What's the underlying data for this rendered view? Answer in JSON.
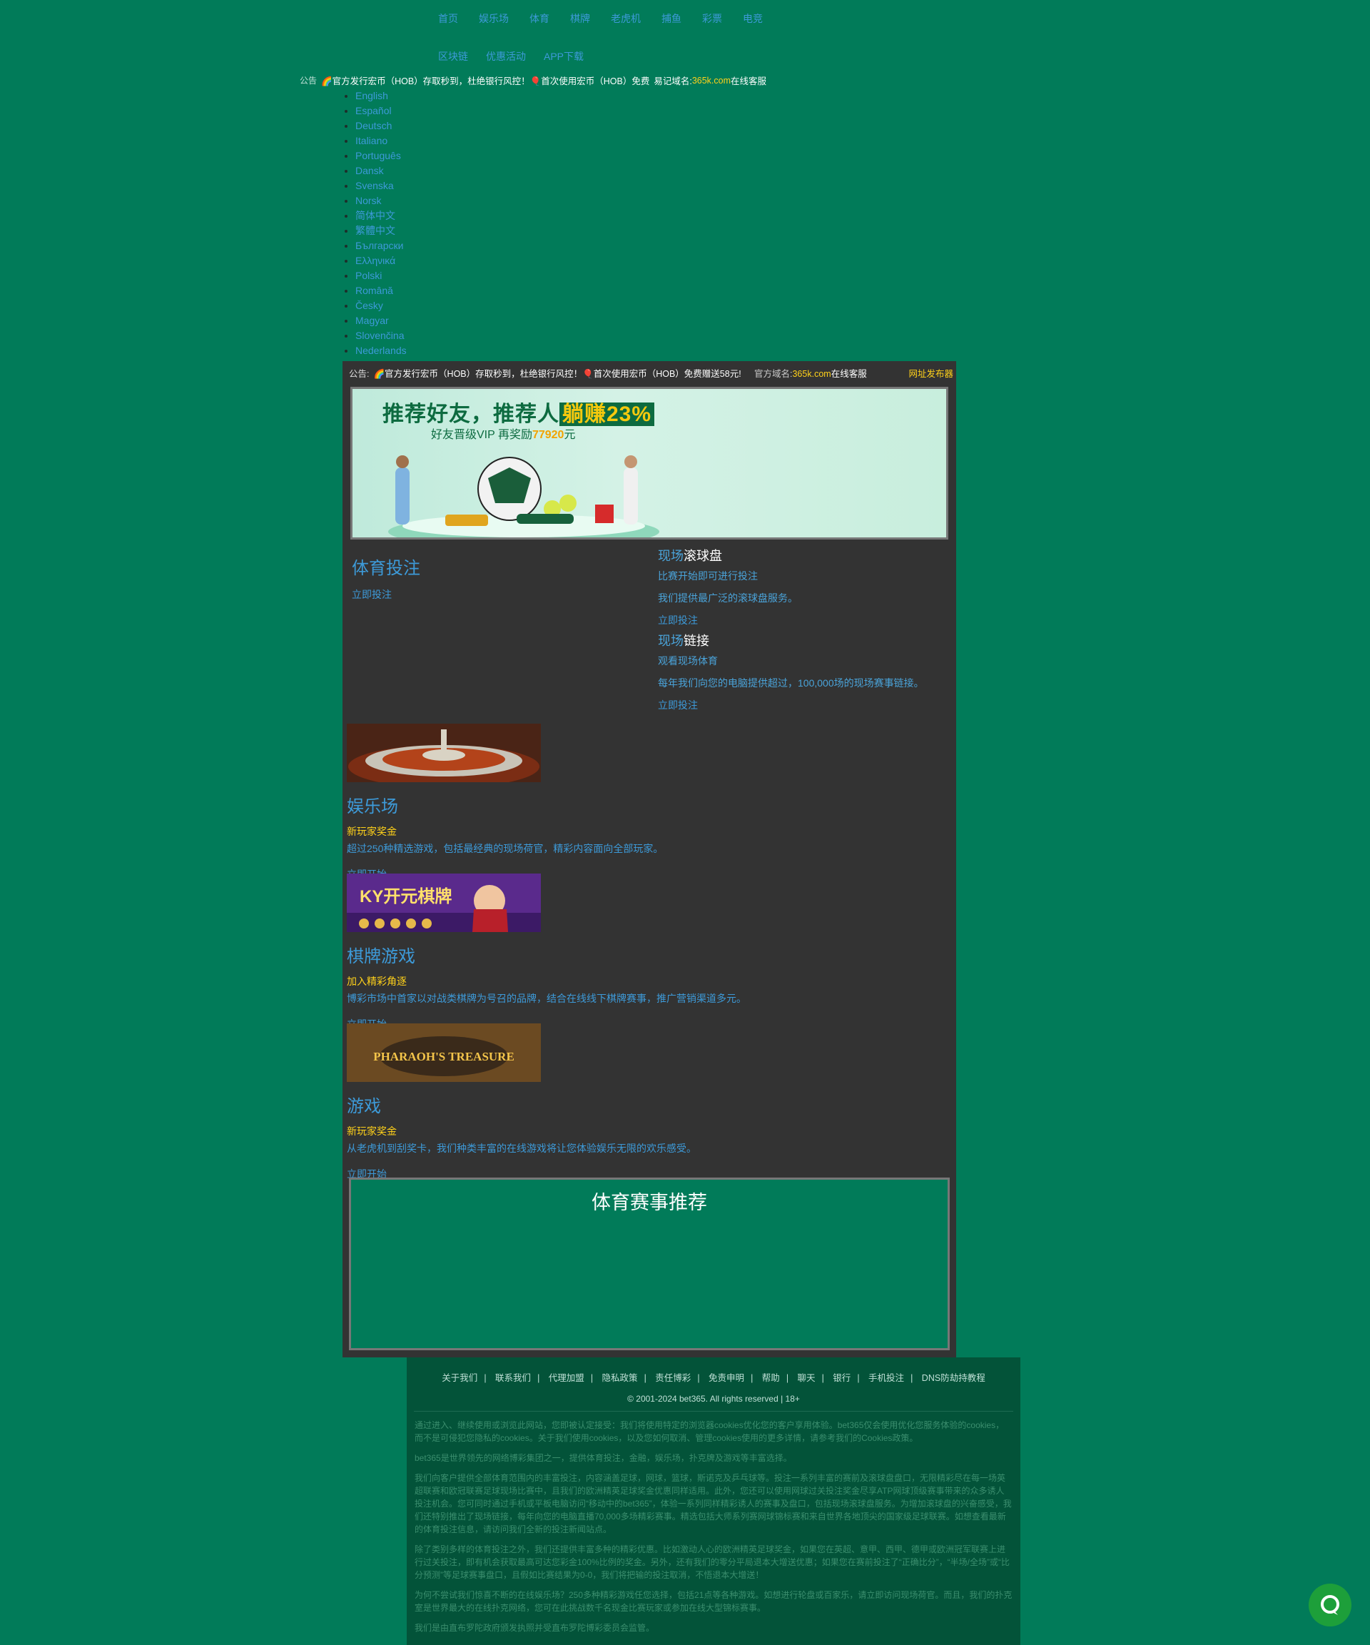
{
  "nav": {
    "row1": [
      "首页",
      "娱乐场",
      "体育",
      "棋牌",
      "老虎机",
      "捕鱼",
      "彩票",
      "电竞"
    ],
    "row2": [
      "区块链",
      "优惠活动",
      "APP下载"
    ]
  },
  "notice_top": {
    "label": "公告",
    "msg": "🌈官方发行宏币（HOB）存取秒到，杜绝银行风控！🎈首次使用宏币（HOB）免费",
    "domain_prefix": "易记域名:",
    "domain": "365k.com",
    "service": "在线客服"
  },
  "languages": [
    "English",
    "Español",
    "Deutsch",
    "Italiano",
    "Português",
    "Dansk",
    "Svenska",
    "Norsk",
    "简体中文",
    "繁體中文",
    "Български",
    "Ελληνικά",
    "Polski",
    "Română",
    "Česky",
    "Magyar",
    "Slovenčina",
    "Nederlands"
  ],
  "ticker": {
    "label": "公告:",
    "msg": "🌈官方发行宏币（HOB）存取秒到，杜绝银行风控！🎈首次使用宏币（HOB）免费赠送58元!",
    "domain_prefix": "官方域名:",
    "domain": "365k.com",
    "service": "在线客服",
    "release": "网址发布器"
  },
  "banner": {
    "title_a": "推荐好友，推荐人",
    "title_b": "躺赚23%",
    "sub_a": "好友晋级VIP 再奖励",
    "sub_b": "77920",
    "sub_c": "元"
  },
  "sports": {
    "title": "体育投注",
    "button": "立即投注"
  },
  "live_ball": {
    "title_a": "现场",
    "title_b": "滚球盘",
    "line1": "比赛开始即可进行投注",
    "line2": "我们提供最广泛的滚球盘服务。",
    "button": "立即投注"
  },
  "live_link": {
    "title_a": "现场",
    "title_b": "链接",
    "line1": "观看现场体育",
    "line2": "每年我们向您的电脑提供超过，100,000场的现场赛事链接。",
    "button": "立即投注"
  },
  "games": [
    {
      "title": "娱乐场",
      "bonus": "新玩家奖金",
      "desc": "超过250种精选游戏，包括最经典的现场荷官，精彩内容面向全部玩家。",
      "button": "立即开始",
      "img_text": ""
    },
    {
      "title": "棋牌游戏",
      "bonus": "加入精彩角逐",
      "desc": "博彩市场中首家以对战类棋牌为号召的品牌，结合在线线下棋牌赛事，推广营销渠道多元。",
      "button": "立即开始",
      "img_text": "KY开元棋牌"
    },
    {
      "title": "游戏",
      "bonus": "新玩家奖金",
      "desc": "从老虎机到刮奖卡，我们种类丰富的在线游戏将让您体验娱乐无限的欢乐感受。",
      "button": "立即开始",
      "img_text": "PHARAOH'S TREASURE"
    }
  ],
  "recommend": {
    "title": "体育赛事推荐"
  },
  "footer": {
    "links": [
      "关于我们",
      "联系我们",
      "代理加盟",
      "隐私政策",
      "责任博彩",
      "免责申明",
      "帮助",
      "聊天",
      "银行",
      "手机投注",
      "DNS防劫持教程"
    ],
    "copyright": "© 2001-2024 bet365. All rights reserved | 18+",
    "p1": "通过进入、继续使用或浏览此网站，您即被认定接受：我们将使用特定的浏览器cookies优化您的客户享用体验。bet365仅会使用优化您服务体验的cookies，而不是可侵犯您隐私的cookies。关于我们使用cookies，以及您如何取消、管理cookies使用的更多详情，请参考我们的Cookies政策。",
    "p2": "bet365是世界领先的网络博彩集团之一，提供体育投注，金融，娱乐场，扑克牌及游戏等丰富选择。",
    "p3": "我们向客户提供全部体育范围内的丰富投注，内容涵盖足球，网球，篮球，斯诺克及乒乓球等。投注一系列丰富的赛前及滚球盘盘口，无限精彩尽在每一场英超联赛和欧冠联赛足球现场比赛中，且我们的欧洲精英足球奖金优惠同样适用。此外，您还可以使用网球过关投注奖金尽享ATP网球顶级赛事带来的众多诱人投注机会。您可同时通过手机或平板电脑访问“移动中的bet365”，体验一系列同样精彩诱人的赛事及盘口，包括现场滚球盘服务。为增加滚球盘的兴奋感受，我们还特别推出了现场链接，每年向您的电脑直播70,000多场精彩赛事。精选包括大师系列赛网球锦标赛和来自世界各地顶尖的国家级足球联赛。如想查看最新的体育投注信息，请访问我们全新的投注新闻站点。",
    "p4": "除了类别多样的体育投注之外，我们还提供丰富多种的精彩优惠。比如激动人心的欧洲精英足球奖金，如果您在英超、意甲、西甲、德甲或欧洲冠军联赛上进行过关投注，即有机会获取最高可达您彩金100%比例的奖金。另外，还有我们的零分平局退本大增送优惠；如果您在赛前投注了“正确比分”，“半场/全场”或“比分预测”等足球赛事盘口，且假如比赛结果为0-0，我们将把输的投注取消，不悟退本大增送！",
    "p5": "为何不尝试我们惊喜不断的在线娱乐场？250多种精彩游戏任您选择，包括21点等各种游戏。如想进行轮盘或百家乐，请立即访问现场荷官。而且，我们的扑克室是世界最大的在线扑克网络，您可在此挑战数千名现金比赛玩家或参加在线大型锦标赛事。",
    "p6": "我们是由直布罗陀政府颁发执照并受直布罗陀博彩委员会监管。"
  },
  "colors": {
    "page_bg": "#017b59",
    "panel_bg": "#333333",
    "link": "#3d9ad8",
    "highlight": "#ffd11a",
    "footer_bg": "#035339"
  }
}
